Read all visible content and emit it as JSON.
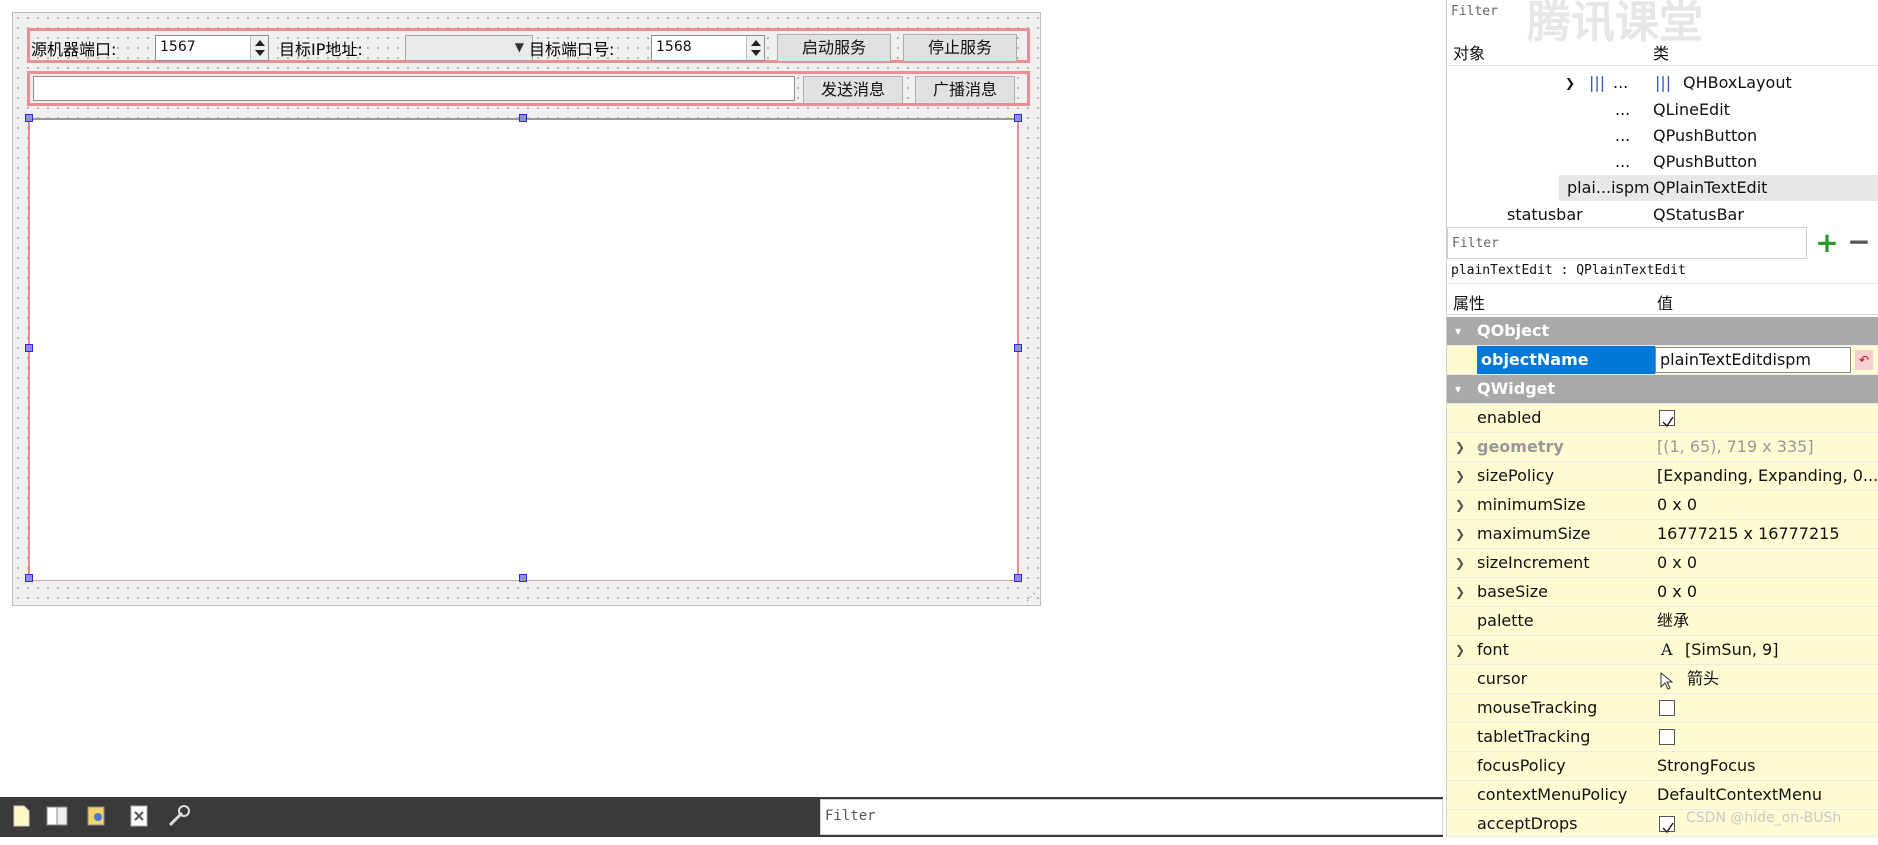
{
  "form": {
    "source_port_label": "源机器端口:",
    "source_port_value": "1567",
    "target_ip_label": "目标IP地址:",
    "target_port_label": "目标端口号:",
    "target_port_value": "1568",
    "start_button": "启动服务",
    "stop_button": "停止服务",
    "send_button": "发送消息",
    "broadcast_button": "广播消息"
  },
  "bottom": {
    "filter_placeholder": "Filter"
  },
  "object_inspector": {
    "filter_placeholder": "Filter",
    "watermark": "腾讯课堂",
    "col_object": "对象",
    "col_class": "类",
    "rows": [
      {
        "name": "...",
        "cls": "QHBoxLayout"
      },
      {
        "name": "...",
        "cls": "QLineEdit"
      },
      {
        "name": "...",
        "cls": "QPushButton"
      },
      {
        "name": "...",
        "cls": "QPushButton"
      },
      {
        "name": "plai...ispm",
        "cls": "QPlainTextEdit"
      },
      {
        "name": "statusbar",
        "cls": "QStatusBar"
      }
    ]
  },
  "property_editor": {
    "filter_placeholder": "Filter",
    "title": "plainTextEdit : QPlainTextEdit",
    "col_property": "属性",
    "col_value": "值",
    "group_qobject": "QObject",
    "objectname_label": "objectName",
    "objectname_value": "plainTextEditdispm",
    "group_qwidget": "QWidget",
    "props": [
      {
        "name": "enabled",
        "value": ""
      },
      {
        "name": "geometry",
        "value": "[(1, 65), 719 x 335]"
      },
      {
        "name": "sizePolicy",
        "value": "[Expanding, Expanding, 0..."
      },
      {
        "name": "minimumSize",
        "value": "0 x 0"
      },
      {
        "name": "maximumSize",
        "value": "16777215 x 16777215"
      },
      {
        "name": "sizeIncrement",
        "value": "0 x 0"
      },
      {
        "name": "baseSize",
        "value": "0 x 0"
      },
      {
        "name": "palette",
        "value": "继承"
      },
      {
        "name": "font",
        "value": "[SimSun, 9]"
      },
      {
        "name": "cursor",
        "value": "箭头"
      },
      {
        "name": "mouseTracking",
        "value": ""
      },
      {
        "name": "tabletTracking",
        "value": ""
      },
      {
        "name": "focusPolicy",
        "value": "StrongFocus"
      },
      {
        "name": "contextMenuPolicy",
        "value": "DefaultContextMenu"
      },
      {
        "name": "acceptDrops",
        "value": ""
      }
    ],
    "font_glyph": "A"
  },
  "footer": {
    "watermark": "CSDN @hide_on-BUSh"
  },
  "colors": {
    "selection": "#0078d7",
    "group_bg": "#a9a9a9",
    "row_yellow": "#fffbd2",
    "layout_border": "#ec8f95",
    "handle": "#2c2ccf"
  }
}
